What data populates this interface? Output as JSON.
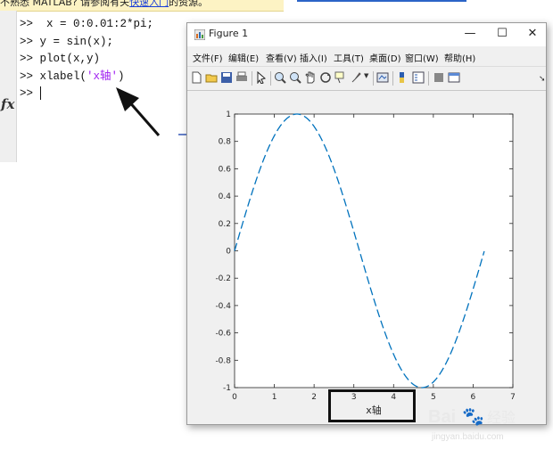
{
  "notice": {
    "text_before": "不熟悉 MATLAB? 请参阅有关",
    "link_text": "快速入门",
    "text_after": "的资源。"
  },
  "command_window": {
    "prompt": ">>",
    "lines": [
      {
        "prompt": ">>",
        "code": "  x = 0:0.01:2*pi;"
      },
      {
        "prompt": ">>",
        "code": " y = sin(x);"
      },
      {
        "prompt": ">>",
        "code": " plot(x,y)"
      },
      {
        "prompt": ">>",
        "code_prefix": " xlabel(",
        "string": "'x轴'",
        "code_suffix": ")"
      },
      {
        "prompt": ">>",
        "code": " "
      }
    ],
    "fx_label": "fx"
  },
  "figure": {
    "title": "Figure 1",
    "window_buttons": {
      "minimize": "—",
      "maximize": "☐",
      "close": "✕"
    },
    "menu": [
      "文件(F)",
      "编辑(E)",
      "查看(V)",
      "插入(I)",
      "工具(T)",
      "桌面(D)",
      "窗口(W)",
      "帮助(H)"
    ],
    "toolbar_icons": [
      "new-figure-icon",
      "open-file-icon",
      "save-icon",
      "print-icon",
      "edit-plot-icon",
      "zoom-in-icon",
      "zoom-out-icon",
      "pan-icon",
      "rotate-3d-icon",
      "data-cursor-icon",
      "brush-icon",
      "link-plot-icon",
      "insert-colorbar-icon",
      "insert-legend-icon",
      "hide-plot-tools-icon",
      "show-plot-tools-icon"
    ]
  },
  "chart_data": {
    "type": "line",
    "function": "sin(x)",
    "x_start": 0,
    "x_end": 6.28,
    "x_step": 0.01,
    "xlabel": "x轴",
    "xlim": [
      0,
      7
    ],
    "ylim": [
      -1,
      1
    ],
    "xticks": [
      "0",
      "1",
      "2",
      "3",
      "4",
      "5",
      "6",
      "7"
    ],
    "yticks": [
      "1",
      "0.8",
      "0.6",
      "0.4",
      "0.2",
      "0",
      "-0.2",
      "-0.4",
      "-0.6",
      "-0.8",
      "-1"
    ],
    "line_color": "#0072bd",
    "line_style": "dashed",
    "grid": false
  },
  "watermark": {
    "brand": "Bai",
    "brand_suffix": "经验",
    "url": "jingyan.baidu.com"
  }
}
